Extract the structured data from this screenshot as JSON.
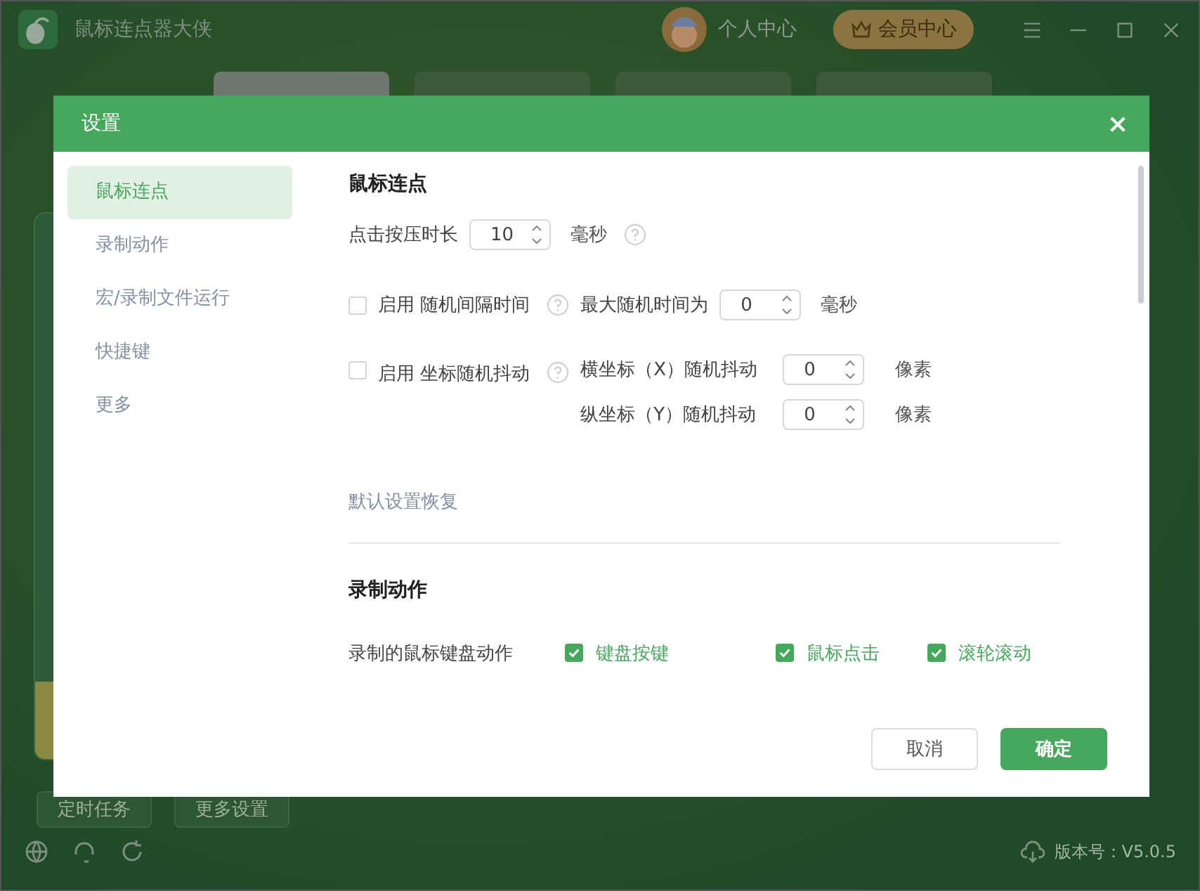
{
  "app": {
    "title": "鼠标连点器大侠",
    "user": "个人中心",
    "vip": "会员中心",
    "tabs": [
      {
        "selected": true
      },
      {
        "selected": false
      },
      {
        "selected": false
      },
      {
        "selected": false
      }
    ],
    "bottom_buttons": [
      "定时任务",
      "更多设置"
    ],
    "version": "版本号：V5.0.5"
  },
  "dialog": {
    "title": "设置",
    "nav": [
      {
        "label": "鼠标连点",
        "selected": true
      },
      {
        "label": "录制动作",
        "selected": false
      },
      {
        "label": "宏/录制文件运行",
        "selected": false
      },
      {
        "label": "快捷键",
        "selected": false
      },
      {
        "label": "更多",
        "selected": false
      }
    ],
    "click": {
      "heading": "鼠标连点",
      "press_label": "点击按压时长",
      "press_value": "10",
      "press_unit": "毫秒",
      "interval": {
        "checked": false,
        "enable": "启用",
        "label": "随机间隔时间",
        "max_label": "最大随机时间为",
        "value": "0",
        "unit": "毫秒"
      },
      "jitter": {
        "checked": false,
        "enable": "启用",
        "label": "坐标随机抖动",
        "x_label": "横坐标（X）随机抖动",
        "x_value": "0",
        "y_label": "纵坐标（Y）随机抖动",
        "y_value": "0",
        "x_unit": "像素",
        "y_unit": "像素"
      },
      "reset": "默认设置恢复"
    },
    "record": {
      "heading": "录制动作",
      "label": "录制的鼠标键盘动作",
      "options": [
        {
          "label": "键盘按键",
          "checked": true
        },
        {
          "label": "鼠标点击",
          "checked": true
        },
        {
          "label": "滚轮滚动",
          "checked": true
        }
      ]
    },
    "cancel": "取消",
    "ok": "确定"
  }
}
